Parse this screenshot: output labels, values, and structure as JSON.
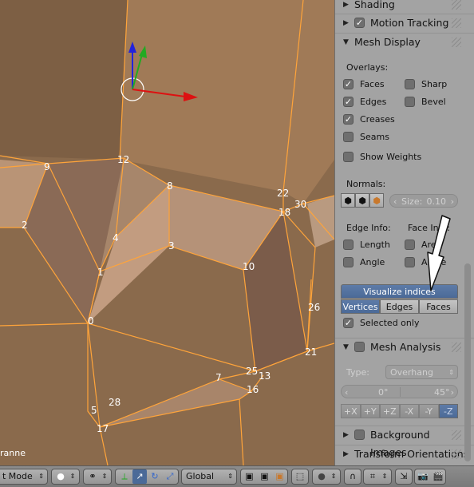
{
  "viewport": {
    "object_name": "ranne",
    "vertex_labels": [
      "0",
      "1",
      "2",
      "3",
      "4",
      "5",
      "7",
      "8",
      "9",
      "10",
      "12",
      "13",
      "16",
      "17",
      "18",
      "21",
      "22",
      "25",
      "26",
      "28",
      "30"
    ]
  },
  "panel": {
    "sections": {
      "shading": "Shading",
      "motion_tracking": "Motion Tracking",
      "mesh_display": "Mesh Display",
      "mesh_analysis": "Mesh Analysis",
      "background_images": "Background Images",
      "transform_orientations": "Transform Orientations"
    },
    "overlays_label": "Overlays:",
    "overlays": {
      "faces": "Faces",
      "sharp": "Sharp",
      "edges": "Edges",
      "bevel": "Bevel",
      "creases": "Creases",
      "seams": "Seams",
      "show_weights": "Show Weights"
    },
    "normals_label": "Normals:",
    "normals_size": "Size:",
    "normals_size_value": "0.10",
    "edge_info_label": "Edge Info:",
    "face_info_label": "Face Info:",
    "edge_info": {
      "length": "Length",
      "angle": "Angle"
    },
    "face_info": {
      "area": "Area",
      "angle": "Angle"
    },
    "visualize_indices": "Visualize indices",
    "indices_tabs": [
      "Vertices",
      "Edges",
      "Faces"
    ],
    "selected_only": "Selected only",
    "analysis_type_label": "Type:",
    "analysis_type_value": "Overhang",
    "analysis_min": "0°",
    "analysis_max": "45°",
    "axes": [
      "+X",
      "+Y",
      "+Z",
      "-X",
      "-Y",
      "-Z"
    ]
  },
  "footer": {
    "mode_label": "t Mode",
    "orientation": "Global"
  },
  "colors": {
    "accent": "#5d7ba8",
    "mesh_edge": "#ffa43a",
    "face_fill": "#b08a6a",
    "panel_bg": "#a3a3a3"
  }
}
